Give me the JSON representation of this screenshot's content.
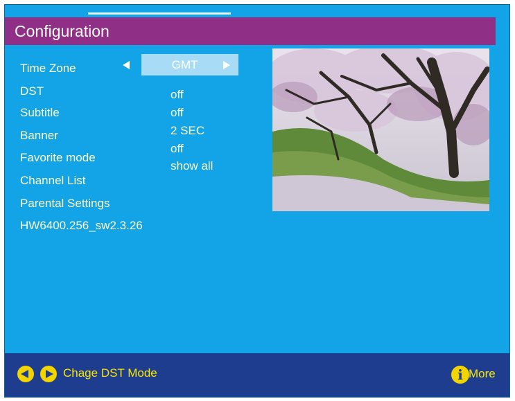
{
  "header": {
    "title": "Configuration"
  },
  "menu": {
    "items": [
      {
        "label": "Time Zone"
      },
      {
        "label": "DST"
      },
      {
        "label": "Subtitle"
      },
      {
        "label": "Banner"
      },
      {
        "label": "Favorite mode"
      },
      {
        "label": "Channel List"
      },
      {
        "label": "Parental Settings"
      }
    ],
    "version": "HW6400.256_sw2.3.26"
  },
  "values": {
    "time_zone": "GMT",
    "dst": "off",
    "subtitle": "off",
    "banner": "2 SEC",
    "favorite_mode": "off",
    "channel_list": "show all"
  },
  "footer": {
    "hint": "Chage DST Mode",
    "more": "More",
    "icons": [
      "left-arrow-icon",
      "right-arrow-icon",
      "info-icon"
    ]
  },
  "colors": {
    "background": "#12a4e6",
    "title_bar": "#8f2f86",
    "footer": "#1f3d8e",
    "text": "#fff9c8",
    "accent_yellow": "#f2d400"
  }
}
